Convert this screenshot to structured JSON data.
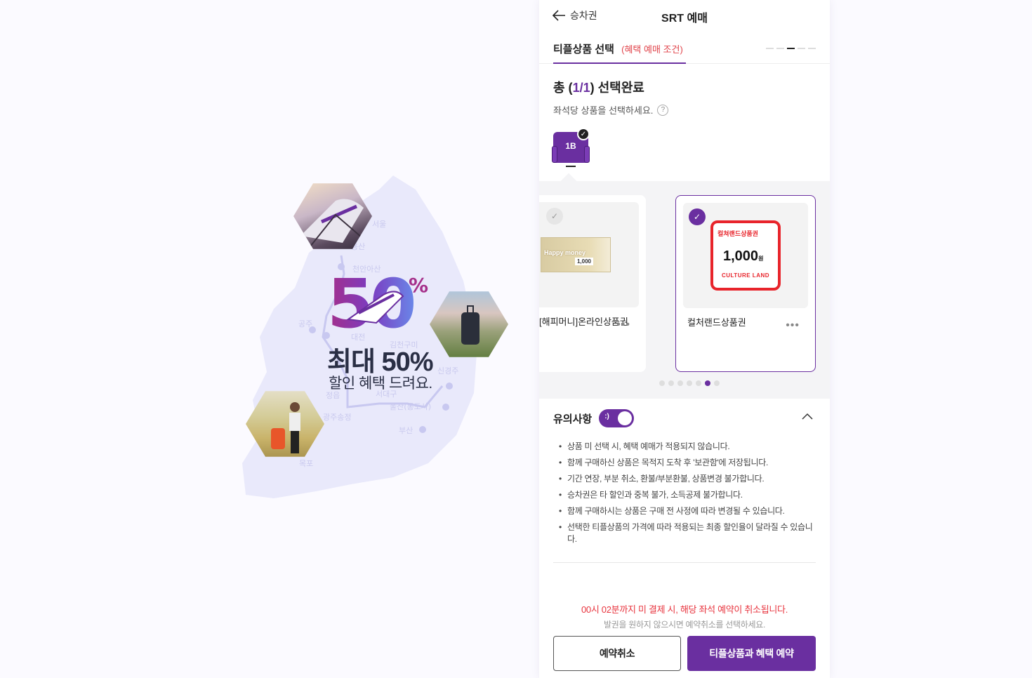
{
  "promo": {
    "big_number": "50",
    "percent_sign": "%",
    "title": "최대 50%",
    "subtitle": "할인 혜택 드려요."
  },
  "header": {
    "back_label": "승차권",
    "title": "SRT 예매"
  },
  "step": {
    "tab_label": "티플상품 선택",
    "condition_label": "(혜택 예매 조건)",
    "total_dots": 5,
    "active_dot": 3
  },
  "summary": {
    "prefix": "총 (",
    "selected": "1/1",
    "suffix": ") 선택완료",
    "hint": "좌석당 상품을 선택하세요.",
    "help_symbol": "?",
    "seat": "1B"
  },
  "products": [
    {
      "name": "[해피머니]온라인상품권",
      "selected": false,
      "ticket_text": "Happy money",
      "ticket_value": "1,000"
    },
    {
      "name": "컬처랜드상품권",
      "selected": true,
      "ticket_head": "컬쳐랜드상품권",
      "ticket_value": "1,000",
      "ticket_unit": "원",
      "ticket_foot": "CULTURE LAND"
    }
  ],
  "carousel": {
    "total_dots": 7,
    "active_dot": 6
  },
  "notice": {
    "label": "유의사항",
    "toggle_face": ":)",
    "toggle_on": true,
    "items": [
      "상품 미 선택 시, 혜택 예매가 적용되지 않습니다.",
      "함께 구매하신 상품은 목적지 도착 후 '보관함'에 저장됩니다.",
      "기간 연장, 부분 취소, 환불/부분환불, 상품변경 불가합니다.",
      "승차권은 타 할인과 중복 불가, 소득공제 불가합니다.",
      "함께 구매하시는 상품은 구매 전 사정에 따라 변경될 수 있습니다.",
      "선택한 티플상품의 가격에 따라 적용되는 최종 할인율이 달라질 수 있습니다."
    ]
  },
  "warning": {
    "red": "00시 02분까지 미 결제 시, 해당 좌석 예약이 취소됩니다.",
    "gray": "발권을 원하지 않으시면 예약취소를 선택하세요."
  },
  "buttons": {
    "cancel": "예약취소",
    "book": "티플상품과 혜택 예약"
  },
  "map_labels": [
    "서울",
    "용산",
    "천안아산",
    "공주",
    "대전",
    "김천구미",
    "신경주",
    "정읍",
    "서대구",
    "광주송정",
    "울산(통도사)",
    "부산",
    "목포"
  ],
  "colors": {
    "accent": "#6a2fa0",
    "warning": "#e8343e",
    "culture_red": "#e8242b"
  }
}
